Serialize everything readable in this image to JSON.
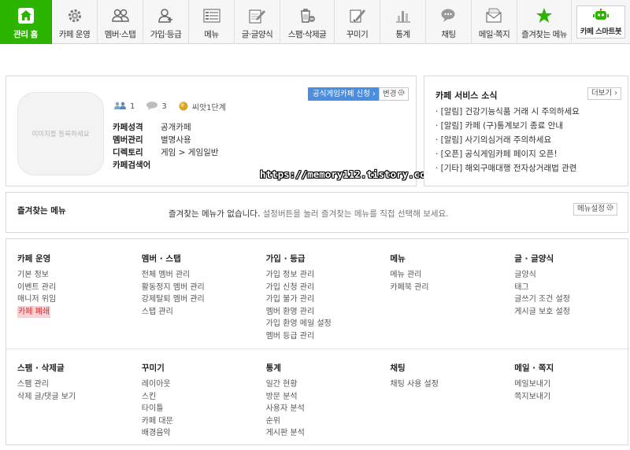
{
  "nav": {
    "tabs": [
      {
        "label": "관리 홈",
        "icon": "house-icon"
      },
      {
        "label": "카페 운영",
        "icon": "gear-icon"
      },
      {
        "label": "멤버·스탭",
        "icon": "users-icon"
      },
      {
        "label": "가입·등급",
        "icon": "user-add-icon"
      },
      {
        "label": "메뉴",
        "icon": "menu-list-icon"
      },
      {
        "label": "글·글양식",
        "icon": "pencil-note-icon"
      },
      {
        "label": "스팸·삭제글",
        "icon": "trash-icon"
      },
      {
        "label": "꾸미기",
        "icon": "brush-icon"
      },
      {
        "label": "통계",
        "icon": "bar-chart-icon"
      },
      {
        "label": "채팅",
        "icon": "chat-bubble-icon"
      },
      {
        "label": "메일·쪽지",
        "icon": "envelope-icon"
      },
      {
        "label": "즐겨찾는 메뉴",
        "icon": "star-icon"
      }
    ],
    "smartbot_label": "카페 스마트봇",
    "accent": "#2db400"
  },
  "profile": {
    "image_placeholder": "이미지를 등록하세요",
    "member_count": "1",
    "comment_count": "3",
    "level": "씨앗1단계",
    "join_button": "공식게임카페 신청",
    "change_button": "변경",
    "info": [
      {
        "key": "카페성격",
        "value": "공개카페"
      },
      {
        "key": "멤버관리",
        "value": "별명사용"
      },
      {
        "key": "디렉토리",
        "value": "게임 > 게임일반"
      },
      {
        "key": "카페검색어",
        "value": ""
      }
    ],
    "watermark": "https://memory112.tistory.com"
  },
  "news": {
    "title": "카페 서비스 소식",
    "more": "더보기",
    "items": [
      "· [알림] 건강기능식품 거래 시 주의하세요",
      "· [알림] 카페 (구)통계보기 종료 안내",
      "· [알림] 사기의심거래 주의하세요",
      "· [오픈] 공식게임카페 페이지 오픈!",
      "· [기타] 해외구매대행 전자상거래법 관련"
    ]
  },
  "favorites": {
    "title": "즐겨찾는 메뉴",
    "message": "즐겨찾는 메뉴가 없습니다.",
    "message_sub": "설정버튼을 눌러 즐겨찾는 메뉴를 직접 선택해 보세요.",
    "setting_button": "메뉴설정"
  },
  "menu_row1": [
    {
      "title": "카페 운영",
      "items": [
        "기본 정보",
        "이벤트 관리",
        "매니저 위임",
        "카페 폐쇄"
      ]
    },
    {
      "title": "멤버 · 스탭",
      "items": [
        "전체 멤버 관리",
        "활동정지 멤버 관리",
        "강제탈퇴 멤버 관리",
        "스탭 관리"
      ]
    },
    {
      "title": "가입 · 등급",
      "items": [
        "가입 정보 관리",
        "가입 신청 관리",
        "가입 불가 관리",
        "멤버 환영 관리",
        "가입 환영 메일 설정",
        "멤버 등급 관리"
      ]
    },
    {
      "title": "메뉴",
      "items": [
        "메뉴 관리",
        "카페북 관리"
      ]
    },
    {
      "title": "글 · 글양식",
      "items": [
        "글양식",
        "태그",
        "글쓰기 조건 설정",
        "게시글 보호 설정"
      ]
    }
  ],
  "menu_row2": [
    {
      "title": "스팸 · 삭제글",
      "items": [
        "스팸 관리",
        "삭제 글/댓글 보기"
      ]
    },
    {
      "title": "꾸미기",
      "items": [
        "레이아웃",
        "스킨",
        "타이틀",
        "카페 대문",
        "배경음악"
      ]
    },
    {
      "title": "통계",
      "items": [
        "일간 현황",
        "방문 분석",
        "사용자 분석",
        "순위",
        "게시판 분석"
      ]
    },
    {
      "title": "채팅",
      "items": [
        "채팅 사용 설정"
      ]
    },
    {
      "title": "메일 · 쪽지",
      "items": [
        "메일보내기",
        "쪽지보내기"
      ]
    }
  ]
}
